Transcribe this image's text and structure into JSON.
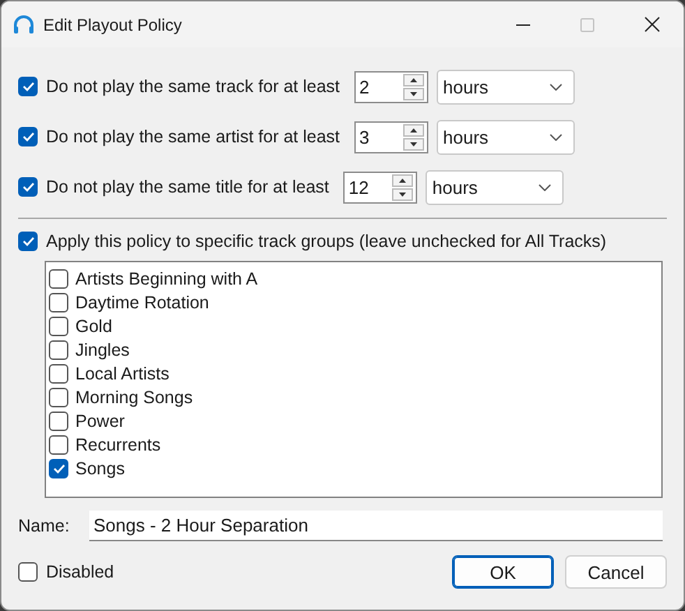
{
  "window": {
    "title": "Edit Playout Policy",
    "maximize_disabled": true
  },
  "rules": [
    {
      "checked": true,
      "label": "Do not play the same track for at least",
      "value": "2",
      "unit": "hours"
    },
    {
      "checked": true,
      "label": "Do not play the same artist for at least",
      "value": "3",
      "unit": "hours"
    },
    {
      "checked": true,
      "label": "Do not play the same title for at least",
      "value": "12",
      "unit": "hours"
    }
  ],
  "apply_groups": {
    "checked": true,
    "label": "Apply this policy to specific track groups (leave unchecked for All Tracks)"
  },
  "groups": [
    {
      "label": "Artists Beginning with A",
      "checked": false
    },
    {
      "label": "Daytime Rotation",
      "checked": false
    },
    {
      "label": "Gold",
      "checked": false
    },
    {
      "label": "Jingles",
      "checked": false
    },
    {
      "label": "Local Artists",
      "checked": false
    },
    {
      "label": "Morning Songs",
      "checked": false
    },
    {
      "label": "Power",
      "checked": false
    },
    {
      "label": "Recurrents",
      "checked": false
    },
    {
      "label": "Songs",
      "checked": true
    }
  ],
  "name": {
    "label": "Name:",
    "value": "Songs - 2 Hour Separation"
  },
  "disabled": {
    "label": "Disabled",
    "checked": false
  },
  "buttons": [
    {
      "label": "OK",
      "default": true
    },
    {
      "label": "Cancel",
      "default": false
    }
  ]
}
